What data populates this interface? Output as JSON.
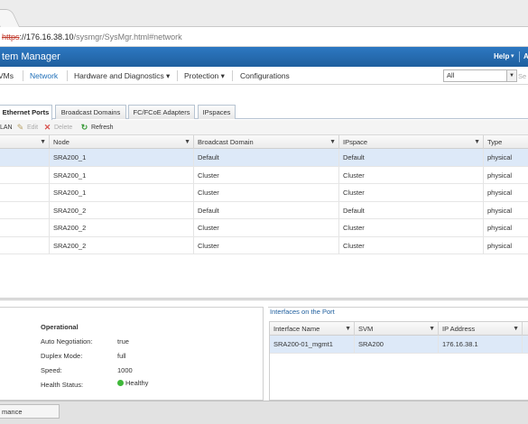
{
  "browser": {
    "url_proto": "https",
    "url_host": "://176.16.38.10",
    "url_path": "/sysmgr/SysMgr.html#network"
  },
  "app": {
    "title": "tem Manager",
    "help_label": "Help",
    "help_caret": "▾",
    "right_initial": "A"
  },
  "menu": {
    "items": [
      {
        "label": "VMs",
        "active": false
      },
      {
        "label": "Network",
        "active": true
      },
      {
        "label": "Hardware and Diagnostics ▾",
        "active": false
      },
      {
        "label": "Protection ▾",
        "active": false
      },
      {
        "label": "Configurations",
        "active": false
      }
    ],
    "filter_select": "All",
    "search_hint": "Se"
  },
  "subtabs": [
    {
      "label": "Ethernet Ports",
      "active": true
    },
    {
      "label": "Broadcast Domains",
      "active": false
    },
    {
      "label": "FC/FCoE Adapters",
      "active": false
    },
    {
      "label": "IPspaces",
      "active": false
    }
  ],
  "toolbar": {
    "vlan_label": "LAN",
    "edit_label": "Edit",
    "delete_label": "Delete",
    "refresh_label": "Refresh"
  },
  "grid": {
    "columns": [
      "Node",
      "Broadcast Domain",
      "IPspace",
      "Type"
    ],
    "rows": [
      [
        "SRA200_1",
        "Default",
        "Default",
        "physical"
      ],
      [
        "SRA200_1",
        "Cluster",
        "Cluster",
        "physical"
      ],
      [
        "SRA200_1",
        "Cluster",
        "Cluster",
        "physical"
      ],
      [
        "SRA200_2",
        "Default",
        "Default",
        "physical"
      ],
      [
        "SRA200_2",
        "Cluster",
        "Cluster",
        "physical"
      ],
      [
        "SRA200_2",
        "Cluster",
        "Cluster",
        "physical"
      ]
    ],
    "selected_row": 0
  },
  "details": {
    "heading": "Operational",
    "auto_negotiation_label": "Auto Negotiation:",
    "auto_negotiation_value": "true",
    "duplex_label": "Duplex Mode:",
    "duplex_value": "full",
    "speed_label": "Speed:",
    "speed_value": "1000",
    "health_label": "Health Status:",
    "health_value": "Healthy"
  },
  "interfaces": {
    "title": "Interfaces on the Port",
    "columns": [
      "Interface Name",
      "SVM",
      "IP Address"
    ],
    "rows": [
      [
        "SRA200-01_mgmt1",
        "SRA200",
        "176.16.38.1"
      ]
    ]
  },
  "bottom": {
    "tab_label": "mance"
  },
  "colors": {
    "header_blue": "#2d78c2",
    "selected_row": "#dde9f8",
    "healthy_green": "#3fb83a"
  }
}
